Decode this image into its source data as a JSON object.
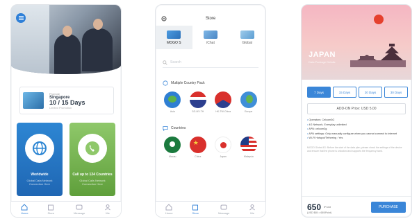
{
  "screen1": {
    "menu_icon": "hamburger-icon",
    "promo": {
      "line1": "Promote",
      "line2": "Singapore",
      "line3": "10 / 15 Days",
      "line4": "Limited Promotion"
    },
    "cards": [
      {
        "title": "Worldwide",
        "subtitle": "Global Data Network Connection Here",
        "color": "#2d86d3",
        "icon": "globe-icon"
      },
      {
        "title": "Call up to 124 Countries",
        "subtitle": "Global Calls Network Connection Here",
        "color": "#8fc86a",
        "icon": "phone-icon"
      }
    ],
    "tabs": [
      "Home",
      "Store",
      "Message",
      "Me"
    ]
  },
  "screen2": {
    "title": "Store",
    "store_tabs": [
      {
        "label": "MOGO S",
        "active": true
      },
      {
        "label": "iChat",
        "active": false
      },
      {
        "label": "Global",
        "active": false
      }
    ],
    "search_placeholder": "Search",
    "multi_section": "Multiple Country Pack",
    "multi_items": [
      {
        "label": "Asia"
      },
      {
        "label": "SG-MY-TH"
      },
      {
        "label": "HK-TW-China"
      },
      {
        "label": "Europe"
      }
    ],
    "countries_section": "Countries",
    "country_items": [
      {
        "label": "Macau"
      },
      {
        "label": "China"
      },
      {
        "label": "Japan"
      },
      {
        "label": "Malaysia"
      }
    ],
    "tabs": [
      "Home",
      "Store",
      "Message",
      "Me"
    ]
  },
  "screen3": {
    "title": "JAPAN",
    "subtitle": "Data Package Details",
    "day_tabs": [
      {
        "label": "7 Days",
        "active": true
      },
      {
        "label": "15 Days",
        "active": false
      },
      {
        "label": "20 Days",
        "active": false
      },
      {
        "label": "30 Days",
        "active": false
      }
    ],
    "addon": "ADD-ON Price: USD 5.00",
    "bullets": [
      "Operators: Celcom3G",
      "4G Network, Everyday unlimited",
      "APN: celcom3g",
      "APN settings: Only manually configure when you cannot connect to internet",
      "Wi-Fi Hotspot/Tethering : Yes"
    ],
    "note": "MOGO Global 4G: Before the start of the data plan, please check the settings of the device and ensure that the phone is unlocked and supports the frequency band.",
    "price": "650",
    "unit": "iPoint",
    "price_sub": "(USD $65 = 650iPoint)",
    "buy_label": "PURCHASE"
  }
}
